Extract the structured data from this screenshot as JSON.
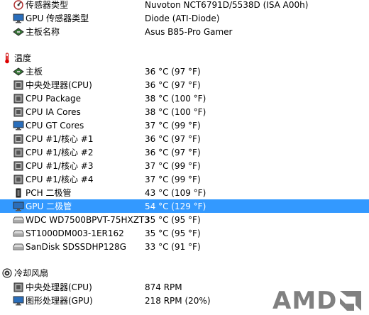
{
  "sensor_props": [
    {
      "label": "传感器类型",
      "value": "Nuvoton NCT6791D/5538D  (ISA A00h)",
      "icon": "sensor-type-icon"
    },
    {
      "label": "GPU 传感器类型",
      "value": "Diode  (ATI-Diode)",
      "icon": "monitor-icon"
    },
    {
      "label": "主板名称",
      "value": "Asus B85-Pro Gamer",
      "icon": "motherboard-icon"
    }
  ],
  "temperature": {
    "title": "温度",
    "icon": "thermometer-icon",
    "items": [
      {
        "label": "主板",
        "value": "36 °C  (97 °F)",
        "icon": "motherboard-icon"
      },
      {
        "label": "中央处理器(CPU)",
        "value": "36 °C  (97 °F)",
        "icon": "cpu-chip-icon"
      },
      {
        "label": "CPU Package",
        "value": "38 °C  (100 °F)",
        "icon": "cpu-chip-icon"
      },
      {
        "label": "CPU IA Cores",
        "value": "38 °C  (100 °F)",
        "icon": "cpu-chip-icon"
      },
      {
        "label": "CPU GT Cores",
        "value": "37 °C  (99 °F)",
        "icon": "monitor-icon"
      },
      {
        "label": "CPU #1/核心 #1",
        "value": "36 °C  (97 °F)",
        "icon": "cpu-chip-icon"
      },
      {
        "label": "CPU #1/核心 #2",
        "value": "36 °C  (97 °F)",
        "icon": "cpu-chip-icon"
      },
      {
        "label": "CPU #1/核心 #3",
        "value": "37 °C  (99 °F)",
        "icon": "cpu-chip-icon"
      },
      {
        "label": "CPU #1/核心 #4",
        "value": "37 °C  (99 °F)",
        "icon": "cpu-chip-icon"
      },
      {
        "label": "PCH 二极管",
        "value": "43 °C  (109 °F)",
        "icon": "pch-chip-icon"
      },
      {
        "label": "GPU 二极管",
        "value": "54 °C  (129 °F)",
        "icon": "monitor-icon",
        "selected": true
      },
      {
        "label": "WDC WD7500BPVT-75HXZT3",
        "value": "35 °C  (95 °F)",
        "icon": "hard-drive-icon"
      },
      {
        "label": "ST1000DM003-1ER162",
        "value": "35 °C  (95 °F)",
        "icon": "hard-drive-icon"
      },
      {
        "label": "SanDisk SDSSDHP128G",
        "value": "33 °C  (91 °F)",
        "icon": "hard-drive-icon"
      }
    ]
  },
  "fans": {
    "title": "冷却风扇",
    "icon": "fan-icon",
    "items": [
      {
        "label": "中央处理器(CPU)",
        "value": "874 RPM",
        "icon": "cpu-chip-icon"
      },
      {
        "label": "图形处理器(GPU)",
        "value": "218 RPM  (20%)",
        "icon": "monitor-icon"
      }
    ]
  },
  "logo": {
    "text": "AMD"
  },
  "colors": {
    "selection": "#3399ff",
    "logo": "#6b6b6b"
  }
}
